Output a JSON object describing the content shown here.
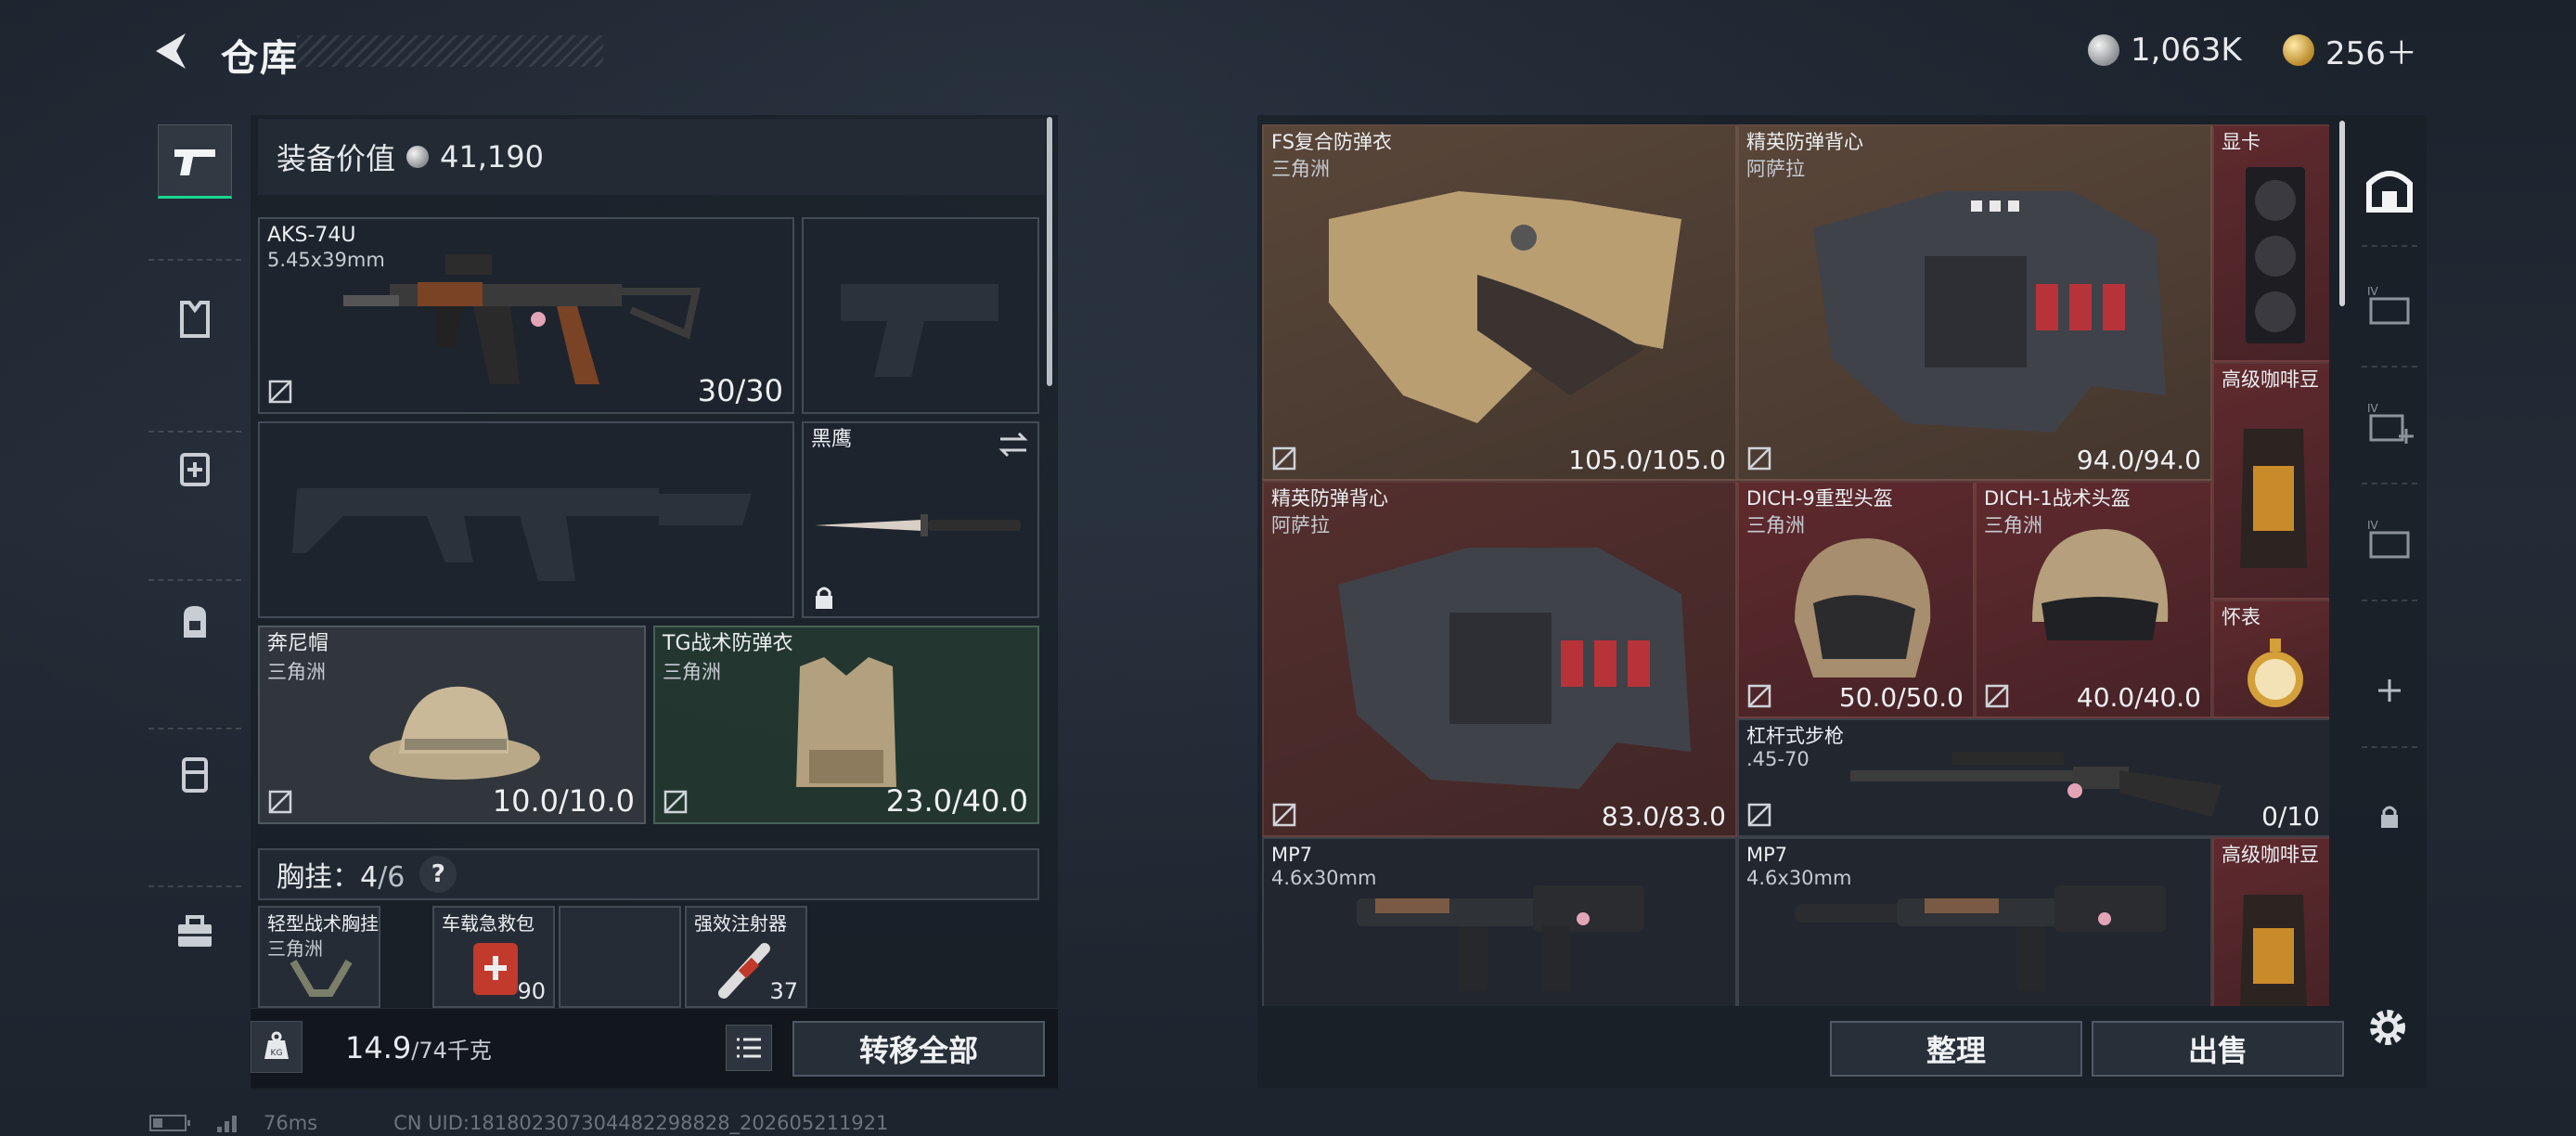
{
  "header": {
    "title": "仓库",
    "silver_amount": "1,063K",
    "gold_amount": "256＋"
  },
  "left_tabs": [
    "pistol-icon",
    "armor-icon",
    "medkit-icon",
    "backpack-icon",
    "chest-rig-icon",
    "toolbox-icon"
  ],
  "equipment": {
    "value_label": "装备价值",
    "value": "41,190",
    "primary_weapon": {
      "name": "AKS-74U",
      "caliber": "5.45x39mm",
      "ammo": "30/30"
    },
    "melee": {
      "name": "黑鹰"
    },
    "helmet": {
      "name": "奔尼帽",
      "origin": "三角洲",
      "durability": "10.0/10.0"
    },
    "armor": {
      "name": "TG战术防弹衣",
      "origin": "三角洲",
      "durability": "23.0/40.0"
    },
    "chest_rig": {
      "label": "胸挂：",
      "count": "4",
      "capacity": "/6",
      "help": "?"
    },
    "rig_items": [
      {
        "name": "轻型战术胸挂",
        "origin": "三角洲"
      },
      {
        "name": "车载急救包",
        "count": "90"
      },
      {
        "name": ""
      },
      {
        "name": "强效注射器",
        "count": "37"
      }
    ]
  },
  "left_footer": {
    "weight": "14.9",
    "weight_max": "/74千克",
    "transfer_all": "转移全部",
    "kg": "KG"
  },
  "stash_items": [
    {
      "name": "FS复合防弹衣",
      "origin": "三角洲",
      "durability": "105.0/105.0"
    },
    {
      "name": "精英防弹背心",
      "origin": "阿萨拉",
      "durability": "94.0/94.0"
    },
    {
      "name": "显卡",
      "origin": ""
    },
    {
      "name": "高级咖啡豆",
      "origin": ""
    },
    {
      "name": "精英防弹背心",
      "origin": "阿萨拉",
      "durability": "83.0/83.0"
    },
    {
      "name": "DICH-9重型头盔",
      "origin": "三角洲",
      "durability": "50.0/50.0"
    },
    {
      "name": "DICH-1战术头盔",
      "origin": "三角洲",
      "durability": "40.0/40.0"
    },
    {
      "name": "怀表",
      "origin": ""
    },
    {
      "name": "杠杆式步枪",
      "origin": ".45-70",
      "durability": "0/10"
    },
    {
      "name": "MP7",
      "origin": "4.6x30mm"
    },
    {
      "name": "MP7",
      "origin": "4.6x30mm"
    },
    {
      "name": "高级咖啡豆",
      "origin": ""
    }
  ],
  "right_footer": {
    "sort": "整理",
    "sell": "出售"
  },
  "right_tabs": [
    "storage-icon",
    "stash-page-1-icon",
    "stash-add-icon",
    "stash-page-3-icon",
    "plus-icon",
    "lock-icon"
  ],
  "status": {
    "ping": "76ms",
    "uid": "CN UID:1818023073044822988​28_202605211921"
  }
}
